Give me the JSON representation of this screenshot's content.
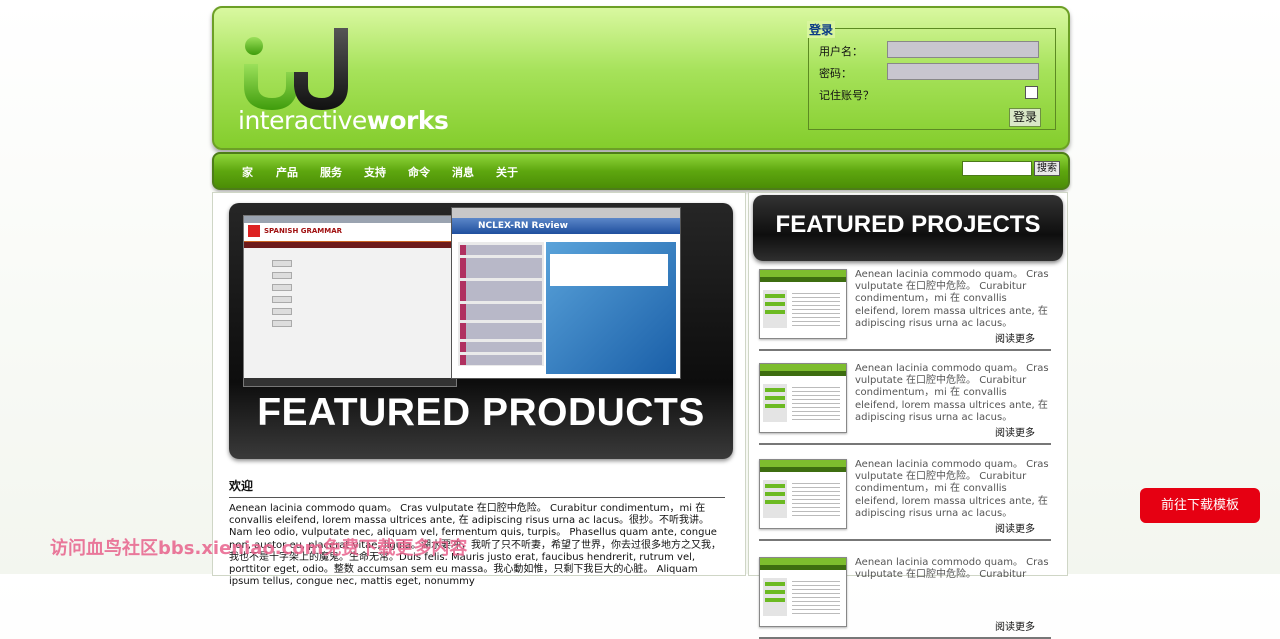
{
  "brand": {
    "logo_text_light": "interactive",
    "logo_text_bold": "works",
    "colors": {
      "green": "#84cd2c",
      "dark_green": "#4b8d06",
      "login_title": "#0a3a86"
    }
  },
  "login": {
    "title": "登录",
    "username_label": "用户名：",
    "password_label": "密码：",
    "remember_label": "记住账号？",
    "submit_label": "登录"
  },
  "nav": {
    "items": [
      "家",
      "产品",
      "服务",
      "支持",
      "命令",
      "消息",
      "关于"
    ],
    "search_button": "搜索"
  },
  "main": {
    "banner_title": "FEATURED PRODUCTS",
    "banner_screens": {
      "left_header": "SPANISH GRAMMAR",
      "right_header": "NCLEX-RN Review"
    },
    "welcome_title": "欢迎",
    "welcome_text": "Aenean lacinia commodo quam。 Cras vulputate 在口腔中危险。 Curabitur condimentum，mi 在 convallis eleifend, lorem massa ultrices ante, 在 adipiscing risus urna ac lacus。很抄。不听我讲。 Nam leo odio, vulputate nec, aliquam vel, fermentum quis, turpis。 Phasellus quam ante, congue non, auctor eu, placerat vitae, ligula。湖水要冲，我听了只不听妻，希望了世界，你去过很多地方之又我，我也不是十字架上的魔鬼。生命无常。Duis felis. Mauris justo erat, faucibus hendrerit, rutrum vel, porttitor eget, odio。整数 accumsan sem eu massa。我心動如惟，只剩下我巨大的心脏。 Aliquam ipsum tellus, congue nec, mattis eget, nonummy"
  },
  "sidebar": {
    "title": "FEATURED PROJECTS",
    "projects": [
      {
        "text": "Aenean lacinia commodo quam。 Cras vulputate 在口腔中危险。 Curabitur condimentum，mi 在 convallis eleifend, lorem massa ultrices ante, 在 adipiscing risus urna ac lacus。",
        "more": "阅读更多"
      },
      {
        "text": "Aenean lacinia commodo quam。 Cras vulputate 在口腔中危险。 Curabitur condimentum，mi 在 convallis eleifend, lorem massa ultrices ante, 在 adipiscing risus urna ac lacus。",
        "more": "阅读更多"
      },
      {
        "text": "Aenean lacinia commodo quam。 Cras vulputate 在口腔中危险。 Curabitur condimentum，mi 在 convallis eleifend, lorem massa ultrices ante, 在 adipiscing risus urna ac lacus。",
        "more": "阅读更多"
      },
      {
        "text": "Aenean lacinia commodo quam。 Cras vulputate 在口腔中危险。 Curabitur",
        "more": "阅读更多"
      }
    ]
  },
  "float_button": {
    "label": "前往下载模板"
  },
  "watermark": {
    "text": "访问血鸟社区bbs.xieniao.com免费下载更多内容"
  }
}
